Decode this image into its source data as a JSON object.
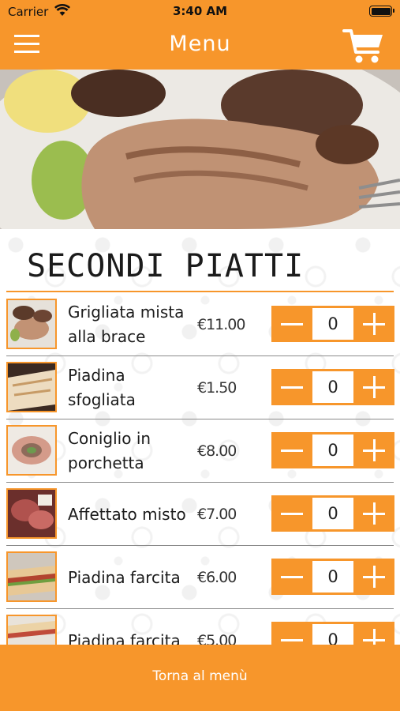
{
  "status_bar": {
    "carrier": "Carrier",
    "time": "3:40 AM"
  },
  "header": {
    "title": "Menu",
    "menu_icon": "hamburger-icon",
    "cart_icon": "cart-icon"
  },
  "hero": {
    "image": "grilled-meat-plate-photo"
  },
  "section": {
    "title": "SECONDI PIATTI"
  },
  "items": [
    {
      "name": "Grigliata mista alla brace",
      "price": "€11.00",
      "qty": "0"
    },
    {
      "name": "Piadina sfogliata",
      "price": "€1.50",
      "qty": "0"
    },
    {
      "name": "Coniglio in porchetta",
      "price": "€8.00",
      "qty": "0"
    },
    {
      "name": "Affettato misto",
      "price": "€7.00",
      "qty": "0"
    },
    {
      "name": "Piadina farcita",
      "price": "€6.00",
      "qty": "0"
    },
    {
      "name": "Piadina farcita",
      "price": "€5.00",
      "qty": "0"
    }
  ],
  "footer": {
    "back_label": "Torna al menù"
  },
  "colors": {
    "accent": "#f7962b"
  }
}
